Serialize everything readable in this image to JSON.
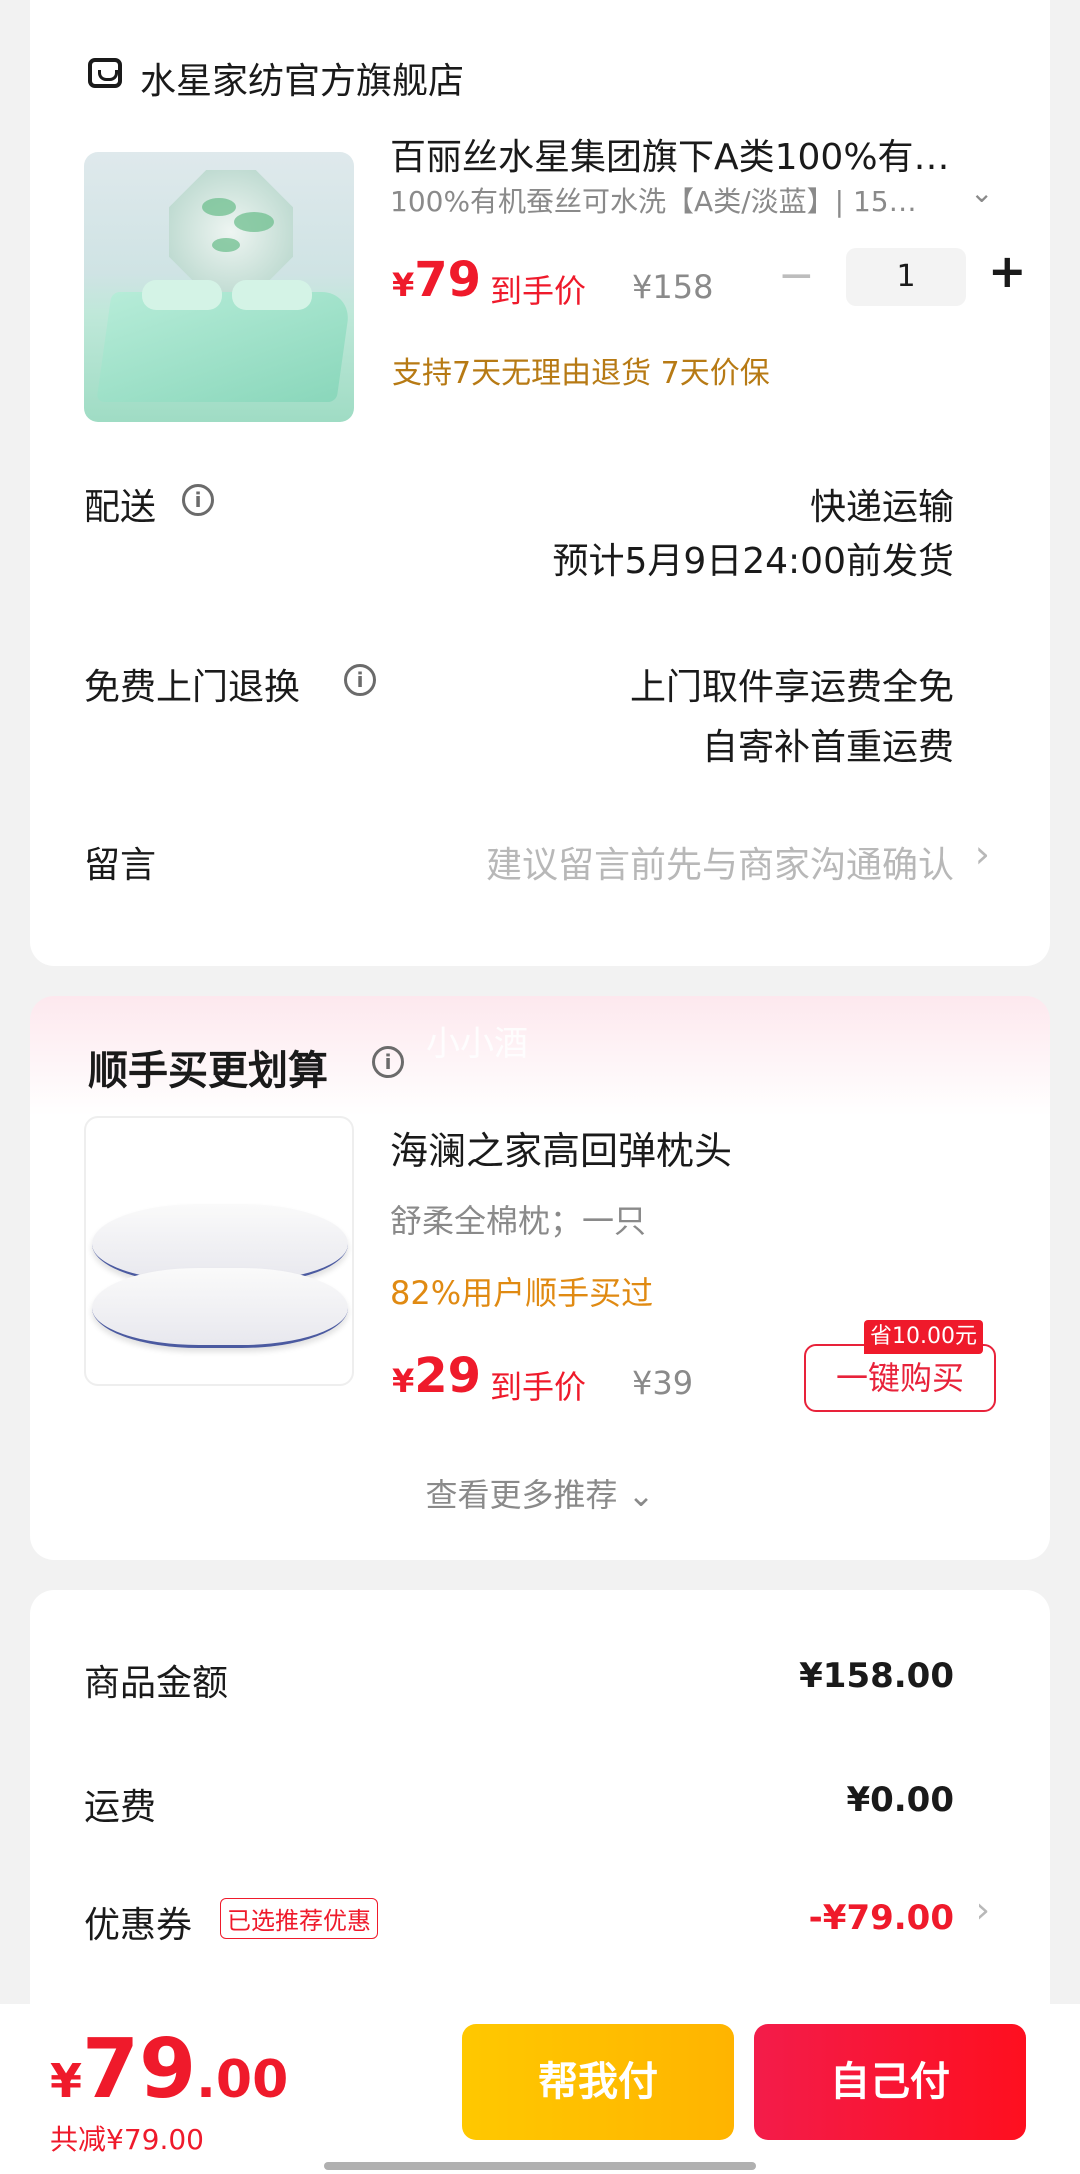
{
  "store": {
    "name": "水星家纺官方旗舰店",
    "icon": "store-icon"
  },
  "product": {
    "title": "百丽丝水星集团旗下A类100%有…",
    "spec": "100%有机蚕丝可水洗【A类/淡蓝】| 15…",
    "price_symbol": "¥",
    "price": "79",
    "price_label": "到手价",
    "original_price": "¥158",
    "quantity": "1",
    "minus": "−",
    "plus": "+",
    "guarantee": "支持7天无理由退货  7天价保"
  },
  "delivery": {
    "label": "配送",
    "method": "快递运输",
    "eta": "预计5月9日24:00前发货"
  },
  "returns": {
    "label": "免费上门退换",
    "line1": "上门取件享运费全免",
    "line2": "自寄补首重运费"
  },
  "note": {
    "label": "留言",
    "placeholder": "建议留言前先与商家沟通确认"
  },
  "recommend": {
    "title": "顺手买更划算",
    "watermark": "小小酒",
    "item": {
      "name": "海澜之家高回弹枕头",
      "desc": "舒柔全棉枕；一只",
      "bought": "82%用户顺手买过",
      "price_symbol": "¥",
      "price": "29",
      "price_label": "到手价",
      "original_price": "¥39",
      "save_badge": "省10.00元",
      "buy_label": "一键购买"
    },
    "more_label": "查看更多推荐 ⌄"
  },
  "summary": {
    "goods_label": "商品金额",
    "goods_value": "¥158.00",
    "shipping_label": "运费",
    "shipping_value": "¥0.00",
    "coupon_label": "优惠券",
    "coupon_badge": "已选推荐优惠",
    "coupon_value": "-¥79.00"
  },
  "bottom": {
    "price_symbol": "¥",
    "price_int": "79",
    "price_dec": ".00",
    "saved": "共减¥79.00",
    "help_pay_label": "帮我付",
    "self_pay_label": "自己付"
  },
  "colors": {
    "accent": "#ef1a2b",
    "gold": "#b77a14",
    "help_btn": "#ffc000",
    "self_btn": "#f81d3a"
  }
}
